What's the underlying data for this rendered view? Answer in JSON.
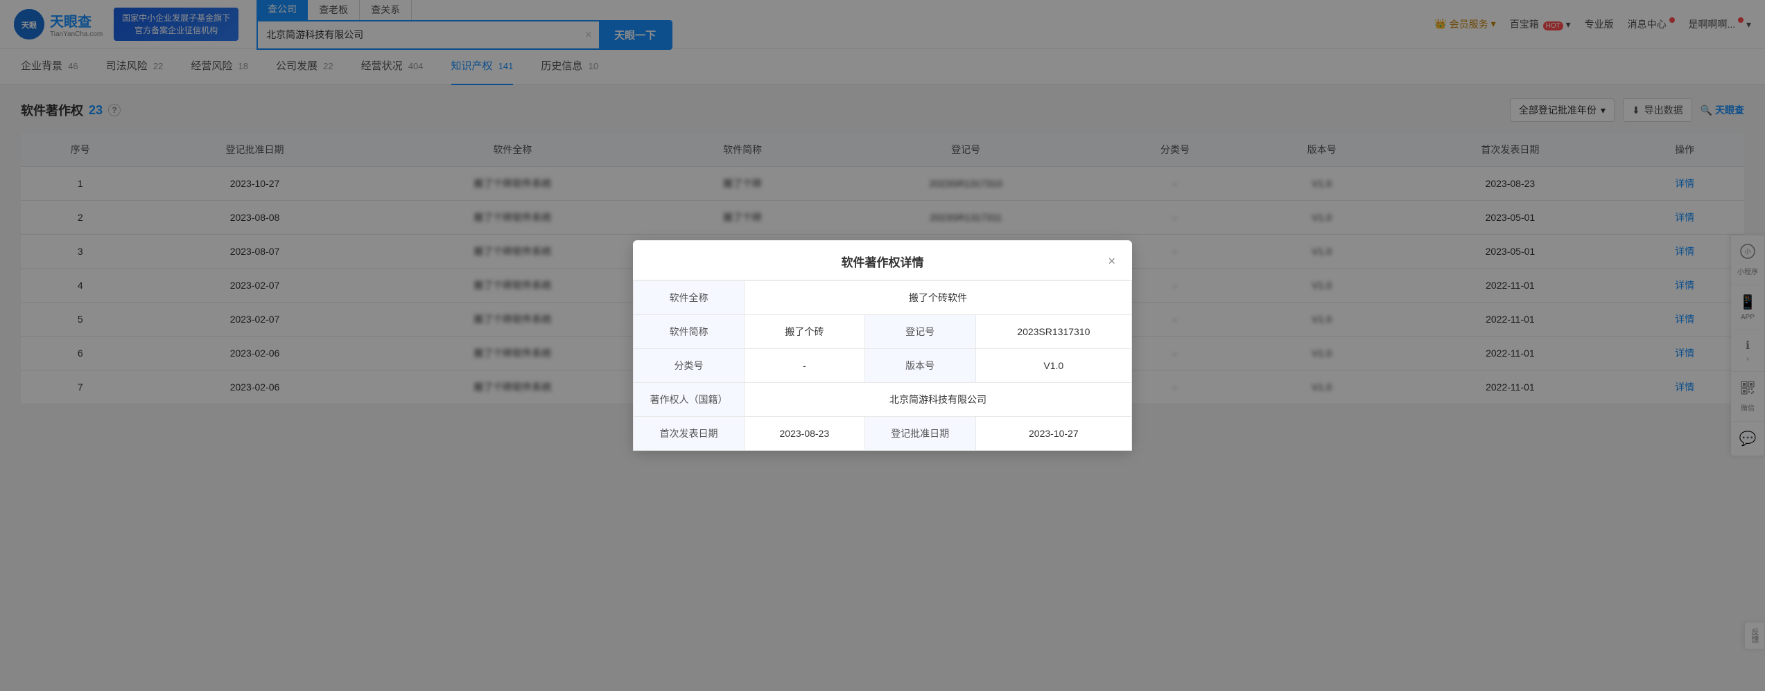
{
  "header": {
    "logo_cn": "天眼查",
    "logo_en": "TianYanCha.com",
    "banner_line1": "国家中小企业发展子基金旗下",
    "banner_line2": "官方备案企业征信机构",
    "search_tabs": [
      {
        "label": "查公司",
        "active": true
      },
      {
        "label": "查老板",
        "active": false
      },
      {
        "label": "查关系",
        "active": false
      }
    ],
    "search_value": "北京简游科技有限公司",
    "search_button": "天眼一下",
    "nav_items": [
      {
        "label": "会员服务",
        "type": "vip"
      },
      {
        "label": "百宝箱",
        "badge": "HOT"
      },
      {
        "label": "专业版"
      },
      {
        "label": "消息中心",
        "dot": true
      },
      {
        "label": "是啊啊啊...",
        "dot": true
      }
    ]
  },
  "sub_nav": {
    "items": [
      {
        "label": "企业背景",
        "count": "46",
        "active": false
      },
      {
        "label": "司法风险",
        "count": "22",
        "active": false
      },
      {
        "label": "经营风险",
        "count": "18",
        "active": false
      },
      {
        "label": "公司发展",
        "count": "22",
        "active": false
      },
      {
        "label": "经营状况",
        "count": "404",
        "active": false
      },
      {
        "label": "知识产权",
        "count": "141",
        "active": true
      },
      {
        "label": "历史信息",
        "count": "10",
        "active": false
      }
    ]
  },
  "section": {
    "title": "软件著作权",
    "count": "23",
    "help_icon": "?",
    "year_filter_label": "全部登记批准年份",
    "export_label": "导出数据",
    "brand": "天眼查"
  },
  "table": {
    "columns": [
      "序号",
      "登记批准日期",
      "软件全称",
      "软件简称",
      "登记号",
      "分类号",
      "版本号",
      "首次发表日期",
      "操作"
    ],
    "rows": [
      {
        "id": 1,
        "date": "2023-10-27",
        "full_name": "",
        "short_name": "",
        "reg_no": "",
        "category": "",
        "version": "",
        "pub_date": "2023-08-23",
        "action": "详情"
      },
      {
        "id": 2,
        "date": "2023-08-08",
        "full_name": "",
        "short_name": "",
        "reg_no": "",
        "category": "",
        "version": "",
        "pub_date": "2023-05-01",
        "action": "详情"
      },
      {
        "id": 3,
        "date": "2023-08-07",
        "full_name": "",
        "short_name": "",
        "reg_no": "",
        "category": "",
        "version": "",
        "pub_date": "2023-05-01",
        "action": "详情"
      },
      {
        "id": 4,
        "date": "2023-02-07",
        "full_name": "",
        "short_name": "",
        "reg_no": "",
        "category": "",
        "version": "",
        "pub_date": "2022-11-01",
        "action": "详情"
      },
      {
        "id": 5,
        "date": "2023-02-07",
        "full_name": "",
        "short_name": "",
        "reg_no": "",
        "category": "",
        "version": "",
        "pub_date": "2022-11-01",
        "action": "详情"
      },
      {
        "id": 6,
        "date": "2023-02-06",
        "full_name": "",
        "short_name": "",
        "reg_no": "",
        "category": "",
        "version": "",
        "pub_date": "2022-11-01",
        "action": "详情"
      },
      {
        "id": 7,
        "date": "2023-02-06",
        "full_name": "",
        "short_name": "",
        "reg_no": "",
        "category": "",
        "version": "",
        "pub_date": "2022-11-01",
        "action": "详情"
      }
    ]
  },
  "modal": {
    "title": "软件著作权详情",
    "close_label": "×",
    "fields": [
      {
        "label": "软件全称",
        "value": "搬了个砖软件",
        "colspan": true
      },
      {
        "label": "软件简称",
        "value": "搬了个砖",
        "label2": "登记号",
        "value2": "2023SR1317310"
      },
      {
        "label": "分类号",
        "value": "-",
        "label2": "版本号",
        "value2": "V1.0"
      },
      {
        "label": "著作权人（国籍）",
        "value": "北京简游科技有限公司",
        "colspan": true
      },
      {
        "label": "首次发表日期",
        "value": "2023-08-23",
        "label2": "登记批准日期",
        "value2": "2023-10-27"
      }
    ]
  },
  "float_panel": {
    "items": [
      {
        "icon": "☁",
        "text": "小程序"
      },
      {
        "icon": "📱",
        "text": "APP"
      },
      {
        "icon": "►",
        "text": ""
      },
      {
        "icon": "▣",
        "text": "微信"
      },
      {
        "icon": "💬",
        "text": ""
      }
    ]
  },
  "feedback": {
    "label": "反馈"
  }
}
